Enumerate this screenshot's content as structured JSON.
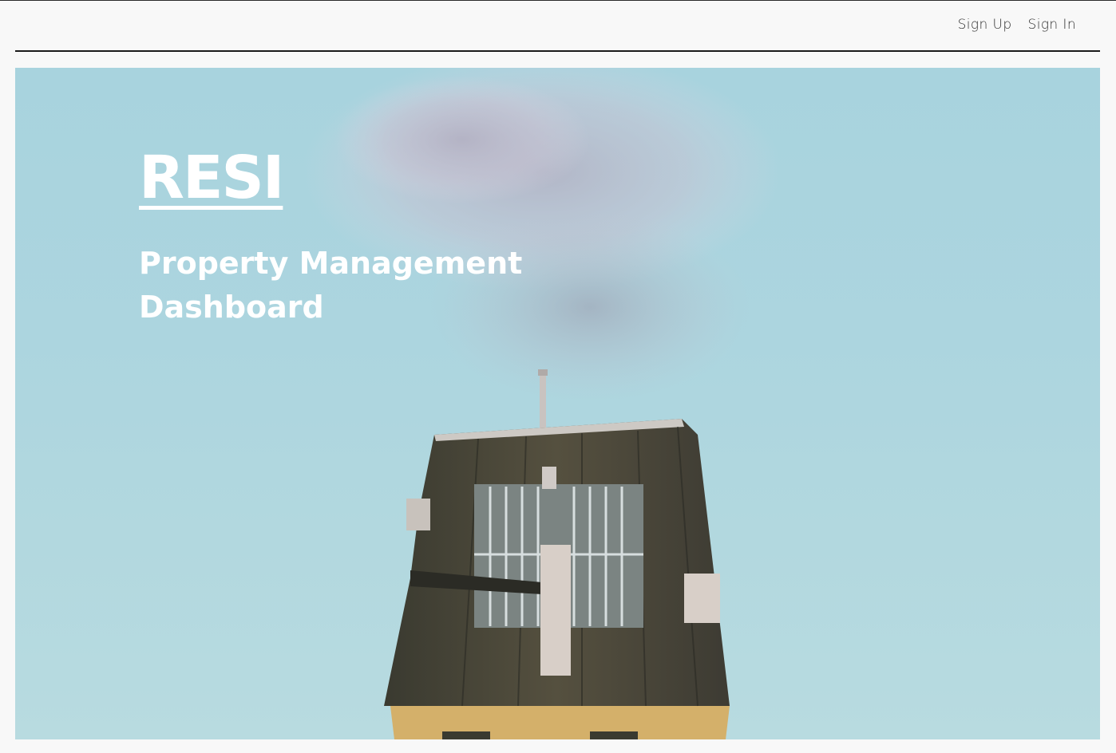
{
  "nav": {
    "sign_up_label": "Sign Up",
    "sign_in_label": "Sign In"
  },
  "hero": {
    "title": "RESI",
    "subtitle": "Property Management Dashboard"
  },
  "colors": {
    "background": "#f8f8f8",
    "sky": "#acd5df",
    "roof": "#4a4a3c",
    "wall": "#d4b06a",
    "text_on_hero": "#ffffff"
  }
}
